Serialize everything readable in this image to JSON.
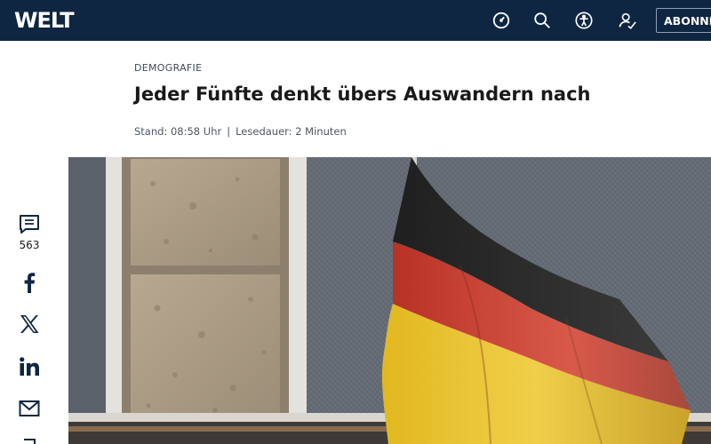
{
  "header": {
    "logo": "WELT",
    "icons": [
      "clock-icon",
      "search-icon",
      "accessibility-icon",
      "user-icon"
    ],
    "subscribe_label": "ABONNEMENT",
    "background_color": "#0e2641"
  },
  "article": {
    "kicker": "DEMOGRAFIE",
    "headline": "Jeder Fünfte denkt übers Auswandern nach",
    "stand": "Stand: 08:58 Uhr",
    "separator": "|",
    "read_time": "Lesedauer: 2 Minuten"
  },
  "share": {
    "comment_count": "563",
    "items": [
      "comments-icon",
      "facebook-icon",
      "x-icon",
      "linkedin-icon",
      "mail-icon"
    ]
  },
  "hero_image": {
    "subject": "german-flag-on-building",
    "flag_colors": [
      "#2b2b2b",
      "#c43a2c",
      "#e9c32a"
    ]
  }
}
